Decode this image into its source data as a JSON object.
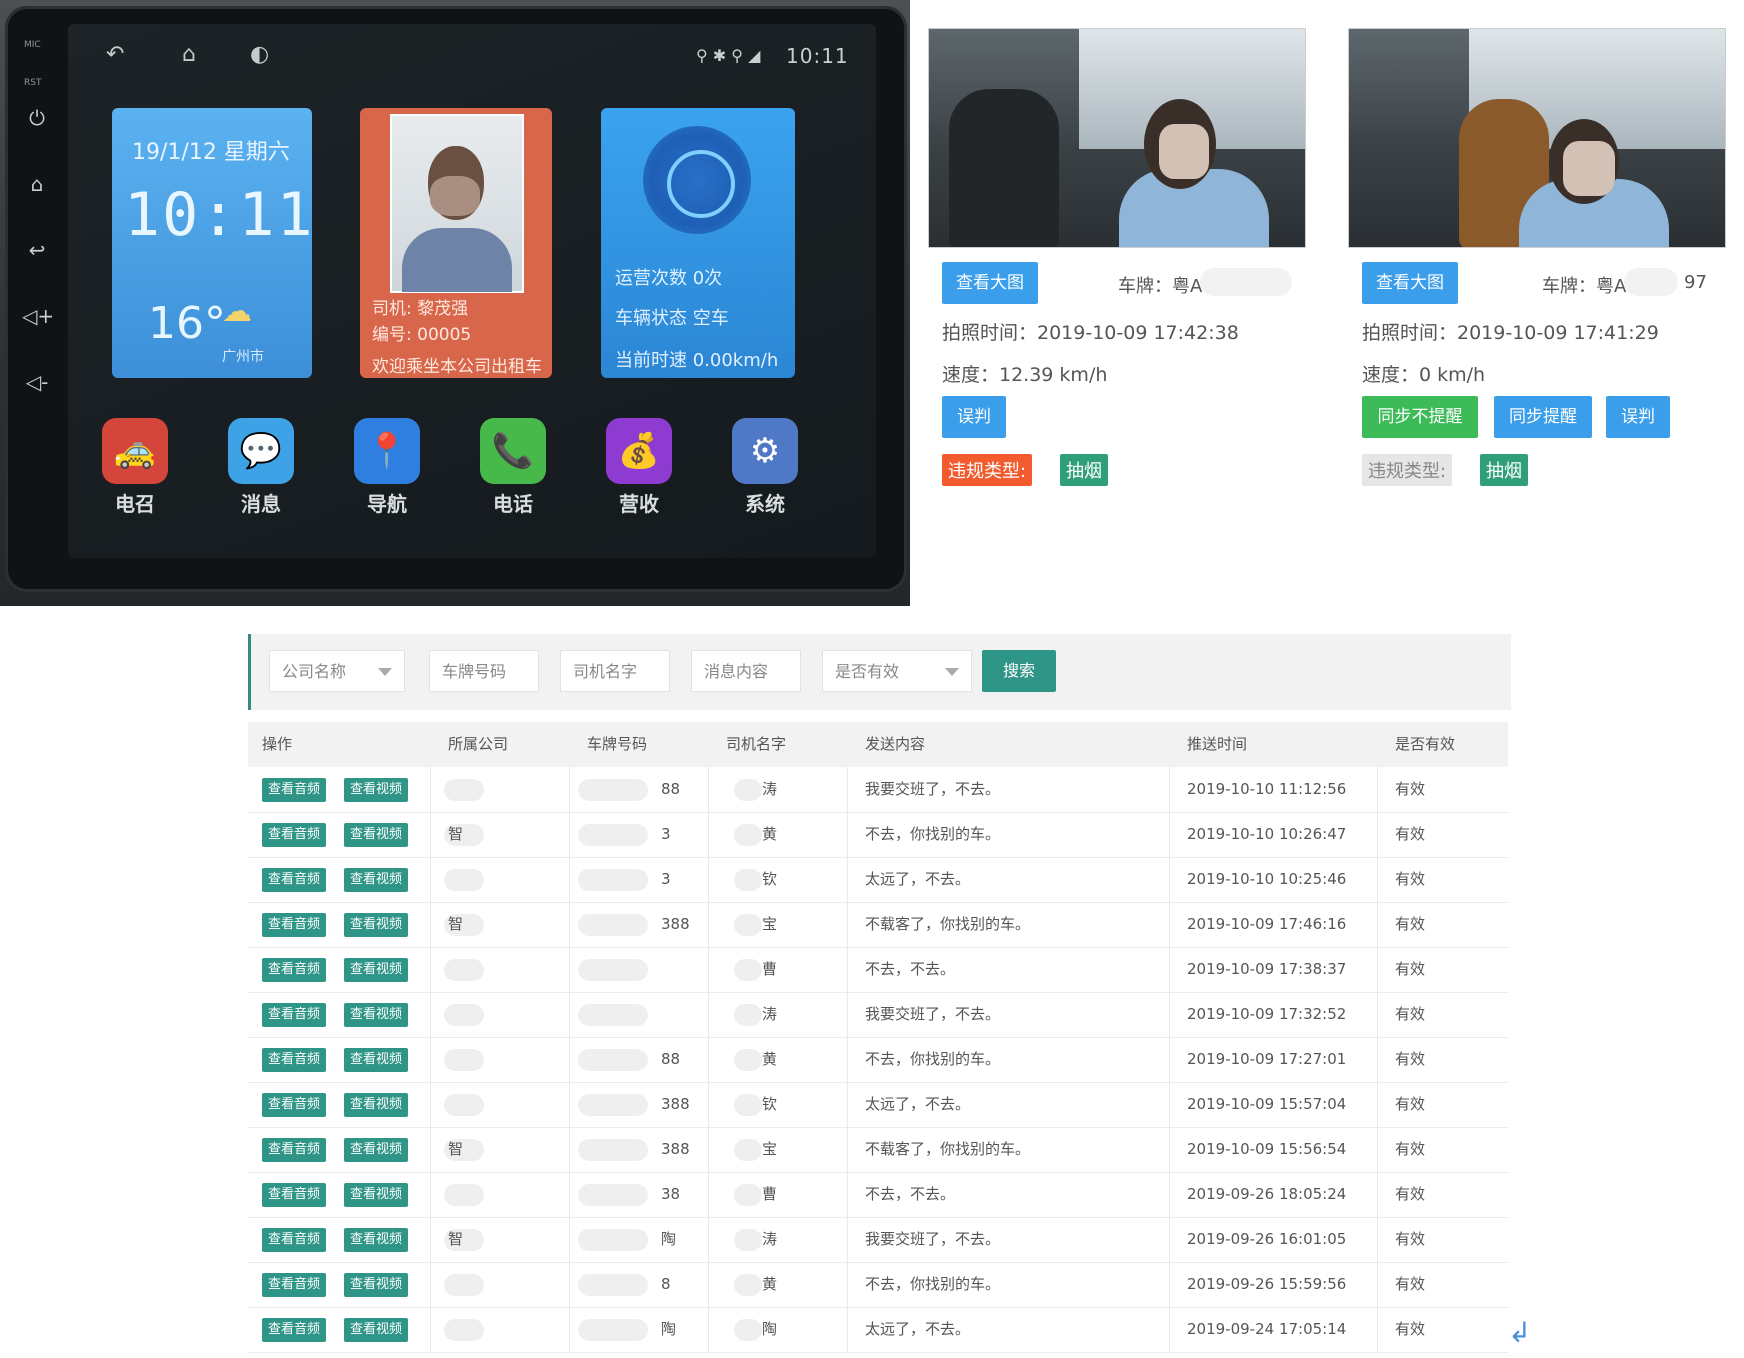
{
  "device": {
    "side_labels": [
      "MIC",
      "RST"
    ],
    "clock": "10:11",
    "time_tile": {
      "date": "19/1/12  星期六",
      "time": "10:11",
      "temp": "16°",
      "city": "广州市"
    },
    "driver_tile": {
      "name_line": "司机: 黎茂强",
      "id_line": "编号: 00005",
      "welcome": "欢迎乘坐本公司出租车"
    },
    "status_tile": {
      "line1": "运营次数  0次",
      "line2": "车辆状态  空车",
      "line3": "当前时速  0.00km/h"
    },
    "apps": [
      {
        "label": "电召",
        "color": "#d4453c",
        "icon": "taxi-call-icon",
        "glyph": "🚕"
      },
      {
        "label": "消息",
        "color": "#3ea2e6",
        "icon": "message-icon",
        "glyph": "💬"
      },
      {
        "label": "导航",
        "color": "#2f7fe0",
        "icon": "location-pin-icon",
        "glyph": "📍"
      },
      {
        "label": "电话",
        "color": "#47b84a",
        "icon": "phone-icon",
        "glyph": "📞"
      },
      {
        "label": "营收",
        "color": "#8d3bd0",
        "icon": "money-bag-icon",
        "glyph": "💰"
      },
      {
        "label": "系统",
        "color": "#4f78c7",
        "icon": "gear-icon",
        "glyph": "⚙"
      }
    ]
  },
  "cards": [
    {
      "view_button": "查看大图",
      "plate_label": "车牌：粤A",
      "plate_suffix": "",
      "photo_time": "拍照时间：2019-10-09 17:42:38",
      "speed": "速度：12.39 km/h",
      "buttons": [
        "误判"
      ],
      "violation_label": "违规类型:",
      "violation_value": "抽烟"
    },
    {
      "view_button": "查看大图",
      "plate_label": "车牌：粤A",
      "plate_suffix": "97",
      "photo_time": "拍照时间：2019-10-09 17:41:29",
      "speed": "速度：0 km/h",
      "buttons": [
        "同步不提醒",
        "同步提醒",
        "误判"
      ],
      "violation_label": "违规类型:",
      "violation_value": "抽烟"
    }
  ],
  "search": {
    "company": "公司名称",
    "plate": "车牌号码",
    "driver": "司机名字",
    "message": "消息内容",
    "valid": "是否有效",
    "button": "搜索"
  },
  "table": {
    "headers": [
      "操作",
      "所属公司",
      "车牌号码",
      "司机名字",
      "发送内容",
      "推送时间",
      "是否有效"
    ],
    "action_audio": "查看音频",
    "action_video": "查看视频",
    "rows": [
      {
        "company": "",
        "plate": "88",
        "driver": "涛",
        "content": "我要交班了，不去。",
        "time": "2019-10-10 11:12:56",
        "valid": "有效"
      },
      {
        "company": "智",
        "plate": "3",
        "driver": "黄",
        "content": "不去，你找别的车。",
        "time": "2019-10-10 10:26:47",
        "valid": "有效"
      },
      {
        "company": "",
        "plate": "3",
        "driver": "钦",
        "content": "太远了，不去。",
        "time": "2019-10-10 10:25:46",
        "valid": "有效"
      },
      {
        "company": "智",
        "plate": "388",
        "driver": "宝",
        "content": "不载客了，你找别的车。",
        "time": "2019-10-09 17:46:16",
        "valid": "有效"
      },
      {
        "company": "",
        "plate": "",
        "driver": "曹",
        "content": "不去，不去。",
        "time": "2019-10-09 17:38:37",
        "valid": "有效"
      },
      {
        "company": "",
        "plate": "",
        "driver": "涛",
        "content": "我要交班了，不去。",
        "time": "2019-10-09 17:32:52",
        "valid": "有效"
      },
      {
        "company": "",
        "plate": "88",
        "driver": "黄",
        "content": "不去，你找别的车。",
        "time": "2019-10-09 17:27:01",
        "valid": "有效"
      },
      {
        "company": "",
        "plate": "388",
        "driver": "钦",
        "content": "太远了，不去。",
        "time": "2019-10-09 15:57:04",
        "valid": "有效"
      },
      {
        "company": "智",
        "plate": "388",
        "driver": "宝",
        "content": "不载客了，你找别的车。",
        "time": "2019-10-09 15:56:54",
        "valid": "有效"
      },
      {
        "company": "",
        "plate": "38",
        "driver": "曹",
        "content": "不去，不去。",
        "time": "2019-09-26 18:05:24",
        "valid": "有效"
      },
      {
        "company": "智",
        "plate": "陶",
        "driver": "涛",
        "content": "我要交班了，不去。",
        "time": "2019-09-26 16:01:05",
        "valid": "有效"
      },
      {
        "company": "",
        "plate": "8",
        "driver": "黄",
        "content": "不去，你找别的车。",
        "time": "2019-09-26 15:59:56",
        "valid": "有效"
      },
      {
        "company": "",
        "plate": "陶",
        "driver": "陶",
        "content": "太远了，不去。",
        "time": "2019-09-24 17:05:14",
        "valid": "有效"
      }
    ]
  }
}
